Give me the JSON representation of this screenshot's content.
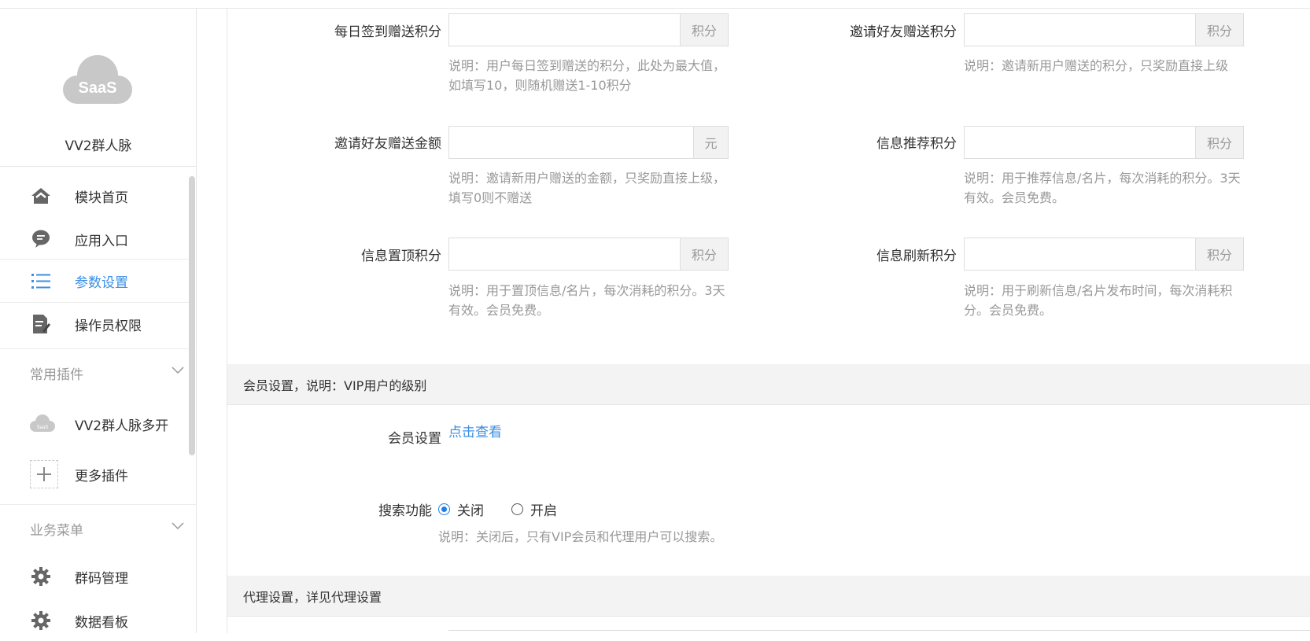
{
  "sidebar": {
    "logo_text": "SaaS",
    "app_name": "VV2群人脉",
    "nav": [
      {
        "label": "模块首页",
        "icon": "home-icon"
      },
      {
        "label": "应用入口",
        "icon": "chat-bubble-icon"
      },
      {
        "label": "参数设置",
        "icon": "list-icon"
      },
      {
        "label": "操作员权限",
        "icon": "edit-document-icon"
      }
    ],
    "groups": {
      "plugins_title": "常用插件",
      "plugins": [
        {
          "label": "VV2群人脉多开",
          "icon": "saas-cloud-icon"
        },
        {
          "label": "更多插件",
          "icon": "plus-icon"
        }
      ],
      "business_title": "业务菜单",
      "business": [
        {
          "label": "群码管理",
          "icon": "gear-icon"
        },
        {
          "label": "数据看板",
          "icon": "gear-icon"
        }
      ]
    },
    "active_color": "#3a8ee6"
  },
  "form": {
    "checkin_points": {
      "label": "每日签到赠送积分",
      "addon": "积分",
      "help": "说明：用户每日签到赠送的积分，此处为最大值，如填写10，则随机赠送1-10积分"
    },
    "invite_points": {
      "label": "邀请好友赠送积分",
      "addon": "积分",
      "help": "说明：邀请新用户赠送的积分，只奖励直接上级"
    },
    "invite_amount": {
      "label": "邀请好友赠送金额",
      "addon": "元",
      "help": "说明：邀请新用户赠送的金额，只奖励直接上级，填写0则不赠送"
    },
    "recommend_points": {
      "label": "信息推荐积分",
      "addon": "积分",
      "help": "说明：用于推荐信息/名片，每次消耗的积分。3天有效。会员免费。"
    },
    "top_points": {
      "label": "信息置顶积分",
      "addon": "积分",
      "help": "说明：用于置顶信息/名片，每次消耗的积分。3天有效。会员免费。"
    },
    "refresh_points": {
      "label": "信息刷新积分",
      "addon": "积分",
      "help": "说明：用于刷新信息/名片发布时间，每次消耗积分。会员免费。"
    }
  },
  "member_section": {
    "title": "会员设置，说明：VIP用户的级别",
    "member_label": "会员设置",
    "member_link": "点击查看",
    "search_label": "搜索功能",
    "radio_off": "关闭",
    "radio_on": "开启",
    "selected": "关闭",
    "search_help": "说明：关闭后，只有VIP会员和代理用户可以搜索。"
  },
  "agent_section": {
    "title": "代理设置，详见代理设置"
  }
}
